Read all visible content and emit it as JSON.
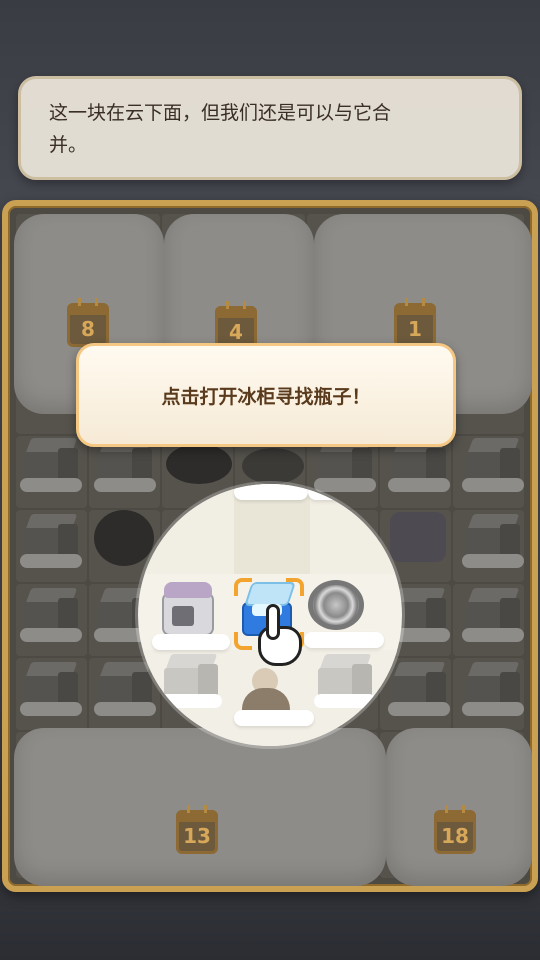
{
  "dialog": {
    "line1": "这一块在云下面，但我们还是可以与它合",
    "line2": "并。"
  },
  "board": {
    "calendar_badges": [
      "8",
      "4",
      "1",
      "13",
      "18"
    ]
  },
  "tutorial": {
    "prompt": "点击打开冰柜寻找瓶子！"
  },
  "colors": {
    "frame_gold": "#caa052",
    "accent_orange": "#f2a42e",
    "cooler_blue": "#2f7be0",
    "toast_text": "#5a3a1c"
  },
  "icons": [
    "calendar-icon",
    "cardboard-box-icon",
    "freezer-icon",
    "cooler-icon",
    "coil-icon",
    "hand-pointer-icon",
    "cloud-icon"
  ]
}
